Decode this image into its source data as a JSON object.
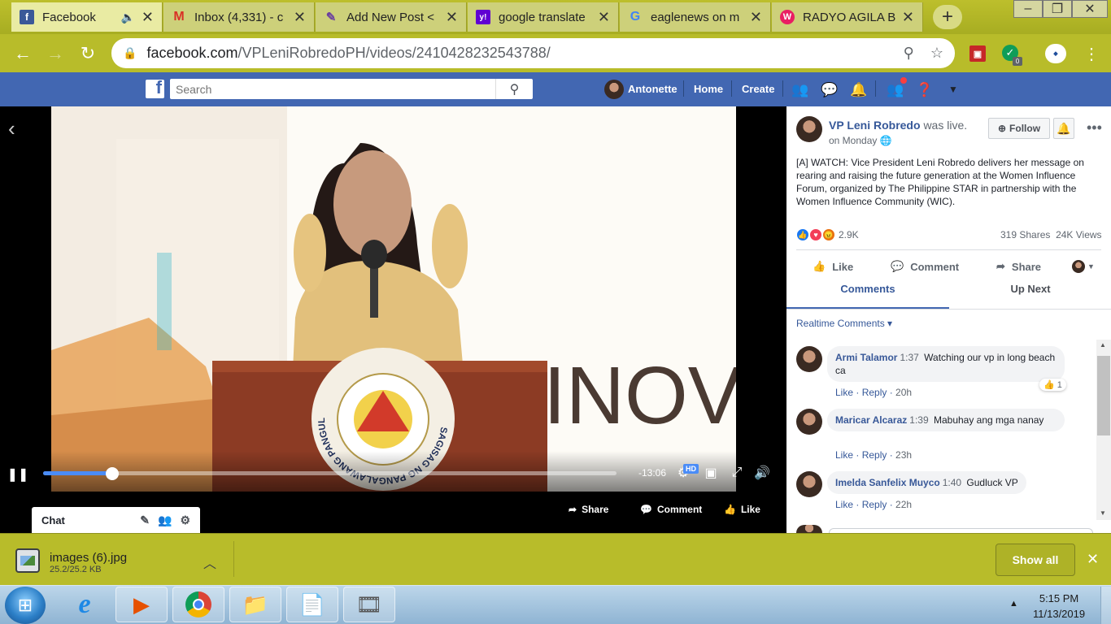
{
  "tabs": [
    {
      "title": "Facebook",
      "icon": "facebook-icon",
      "color": "#3b5998",
      "glyph": "f"
    },
    {
      "title": "Inbox (4,331) - c",
      "icon": "gmail-icon",
      "color": "#ffffff",
      "glyph": "M"
    },
    {
      "title": "Add New Post <",
      "icon": "wordpress-post-icon",
      "color": "#ffffff",
      "glyph": "✎"
    },
    {
      "title": "google translate",
      "icon": "yahoo-icon",
      "color": "#6001d2",
      "glyph": "y!"
    },
    {
      "title": "eaglenews on m",
      "icon": "google-icon",
      "color": "#ffffff",
      "glyph": "G"
    },
    {
      "title": "RADYO AGILA B",
      "icon": "radyo-agila-icon",
      "color": "#e91e63",
      "glyph": "W"
    }
  ],
  "address": {
    "host": "facebook.com",
    "path": "/VPLeniRobredoPH/videos/2410428232543788/"
  },
  "extension_badge": "0",
  "fb": {
    "search_placeholder": "Search",
    "user_name": "Antonette",
    "home": "Home",
    "create": "Create"
  },
  "video": {
    "podium_seal_text": "SAGISAG NG PANGALAWANG PANGULO NG PILIPINAS",
    "backdrop_text": "INOV",
    "time_remaining": "-13:06",
    "hd_badge": "HD",
    "progress_fraction": 0.12
  },
  "video_actions": {
    "share": "Share",
    "comment": "Comment",
    "like": "Like"
  },
  "chat": {
    "label": "Chat"
  },
  "post": {
    "page_name": "VP Leni Robredo",
    "status": "was live.",
    "time": "on Monday",
    "follow_label": "Follow",
    "description": "[A] WATCH: Vice President Leni Robredo delivers her message on rearing and raising the future generation at the Women Influence Forum, organized by The Philippine STAR in partnership with the Women Influence Community (WIC).",
    "reactions_count": "2.9K",
    "shares": "319 Shares",
    "views": "24K Views",
    "like_label": "Like",
    "comment_label": "Comment",
    "share_label": "Share"
  },
  "panel_tabs": {
    "comments": "Comments",
    "up_next": "Up Next"
  },
  "realtime_label": "Realtime Comments",
  "comments": [
    {
      "name": "Armi Talamor",
      "time": "1:37",
      "text": "Watching our vp in long beach ca",
      "like": "Like",
      "reply": "Reply",
      "age": "20h",
      "reactions": "1"
    },
    {
      "name": "Maricar Alcaraz",
      "time": "1:39",
      "text": "Mabuhay ang mga nanay",
      "like": "Like",
      "reply": "Reply",
      "age": "23h"
    },
    {
      "name": "Imelda Sanfelix Muyco",
      "time": "1:40",
      "text": "Gudluck VP",
      "like": "Like",
      "reply": "Reply",
      "age": "22h"
    }
  ],
  "download": {
    "filename": "images (6).jpg",
    "size": "25.2/25.2 KB",
    "show_all": "Show all"
  },
  "taskbar": {
    "time": "5:15 PM",
    "date": "11/13/2019"
  },
  "colors": {
    "chrome_theme": "#b8bc2a",
    "facebook_blue": "#4267b2",
    "link_blue": "#365899",
    "video_progress": "#4a8cf7"
  }
}
